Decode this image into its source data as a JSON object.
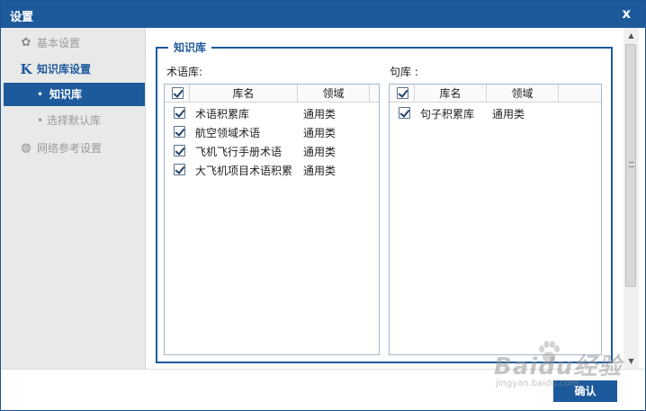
{
  "window": {
    "title": "设置",
    "close_label": "x"
  },
  "sidebar": {
    "items": [
      {
        "label": "基本设置",
        "icon": "gear-icon",
        "glyph": "✿"
      },
      {
        "label": "知识库设置",
        "icon": "k-logo-icon",
        "glyph": "K"
      },
      {
        "label": "知识库",
        "bullet": "•"
      },
      {
        "label": "选择默认库",
        "bullet": "•"
      },
      {
        "label": "网络参考设置",
        "icon": "globe-icon",
        "glyph": "◍"
      }
    ]
  },
  "knowledge": {
    "legend": "知识库",
    "term_library": {
      "label": "术语库:",
      "columns": {
        "name": "库名",
        "domain": "领域"
      },
      "rows": [
        {
          "name": "术语积累库",
          "domain": "通用类"
        },
        {
          "name": "航空领域术语",
          "domain": "通用类"
        },
        {
          "name": "飞机飞行手册术语",
          "domain": "通用类"
        },
        {
          "name": "大飞机项目术语积累",
          "domain": "通用类"
        }
      ]
    },
    "sentence_library": {
      "label": "句库 :",
      "columns": {
        "name": "库名",
        "domain": "领域"
      },
      "rows": [
        {
          "name": "句子积累库",
          "domain": "通用类"
        }
      ]
    }
  },
  "footer": {
    "ok_label": "确认"
  },
  "watermark": {
    "text": "Baidu经验",
    "url": "jingyan.baidu.com"
  },
  "colors": {
    "accent": "#1d5a9c",
    "sidebar_bg": "#e9e9e9"
  }
}
